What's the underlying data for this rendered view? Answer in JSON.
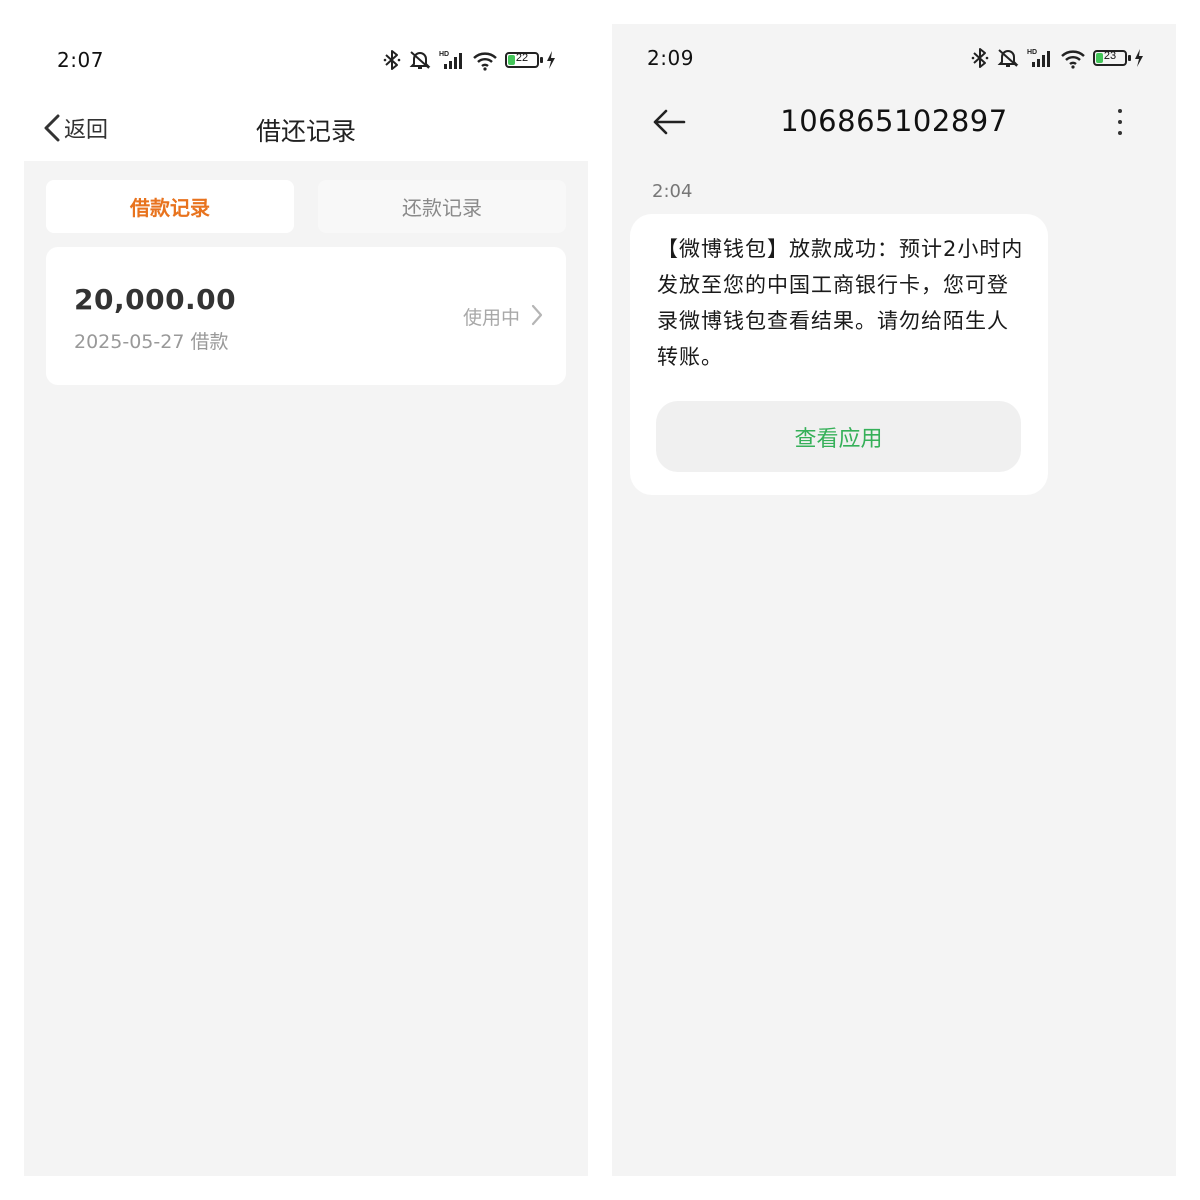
{
  "left": {
    "status": {
      "time": "2:07",
      "battery": "22",
      "battery_level": 0.22
    },
    "header": {
      "back_label": "返回",
      "title": "借还记录"
    },
    "tabs": [
      {
        "label": "借款记录",
        "active": true
      },
      {
        "label": "还款记录",
        "active": false
      }
    ],
    "records": [
      {
        "amount": "20,000.00",
        "date": "2025-05-27 借款",
        "status": "使用中"
      }
    ]
  },
  "right": {
    "status": {
      "time": "2:09",
      "battery": "23",
      "battery_level": 0.23
    },
    "header": {
      "sender": "106865102897"
    },
    "message": {
      "time": "2:04",
      "text": "【微博钱包】放款成功：预计2小时内发放至您的中国工商银行卡，您可登录微博钱包查看结果。请勿给陌生人转账。",
      "action_label": "查看应用"
    }
  },
  "colors": {
    "accent_orange": "#e8731e",
    "action_green": "#36b059",
    "battery_green": "#43c559",
    "background": "#f4f4f4"
  },
  "icons": [
    "bluetooth-icon",
    "mute-icon",
    "hd-signal-icon",
    "wifi-icon",
    "battery-icon",
    "charging-icon",
    "chevron-left-icon",
    "chevron-right-icon",
    "arrow-left-icon",
    "more-vertical-icon"
  ]
}
